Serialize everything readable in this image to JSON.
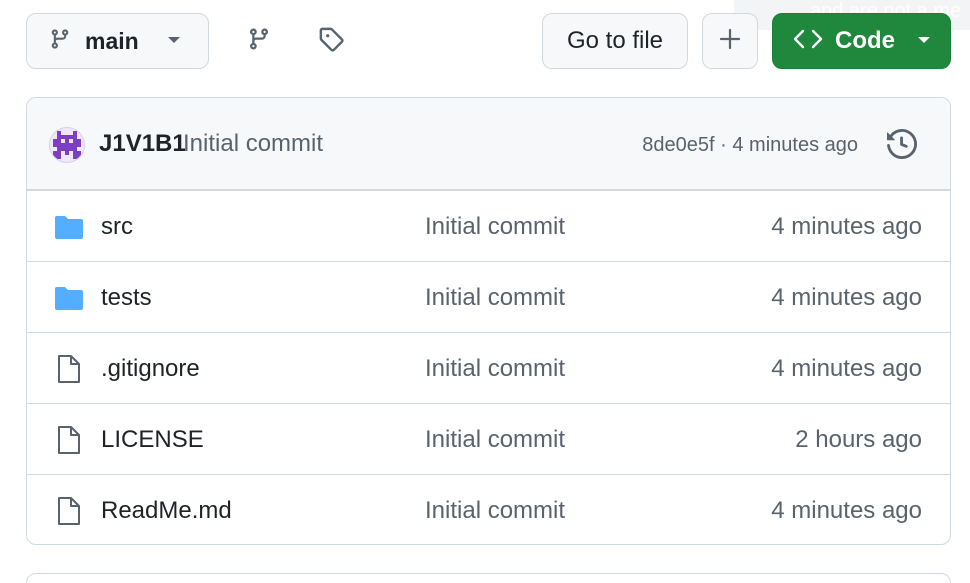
{
  "toolbar": {
    "branch_label": "main",
    "branch_icon": "git-branch-icon",
    "branches_icon": "git-branch-icon",
    "tags_icon": "tag-icon",
    "goto_file_label": "Go to file",
    "add_icon": "plus-icon",
    "code_label": "Code",
    "code_icon": "code-icon",
    "code_color": "#1f883d"
  },
  "overlay": {
    "text": "and are not a me"
  },
  "latest_commit": {
    "author": "J1V1B1",
    "message": "Initial commit",
    "meta": "8de0e5f · 4 minutes ago",
    "history_icon": "history-icon"
  },
  "files": [
    {
      "name": "src",
      "type": "directory",
      "icon": "folder-icon",
      "commit": "Initial commit",
      "time": "4 minutes ago"
    },
    {
      "name": "tests",
      "type": "directory",
      "icon": "folder-icon",
      "commit": "Initial commit",
      "time": "4 minutes ago"
    },
    {
      "name": ".gitignore",
      "type": "file",
      "icon": "file-icon",
      "commit": "Initial commit",
      "time": "4 minutes ago"
    },
    {
      "name": "LICENSE",
      "type": "file",
      "icon": "file-icon",
      "commit": "Initial commit",
      "time": "2 hours ago"
    },
    {
      "name": "ReadMe.md",
      "type": "file",
      "icon": "file-icon",
      "commit": "Initial commit",
      "time": "4 minutes ago"
    }
  ],
  "colors": {
    "folder": "#54aeff",
    "muted_text": "#59636e",
    "border": "#d1d9e0"
  }
}
